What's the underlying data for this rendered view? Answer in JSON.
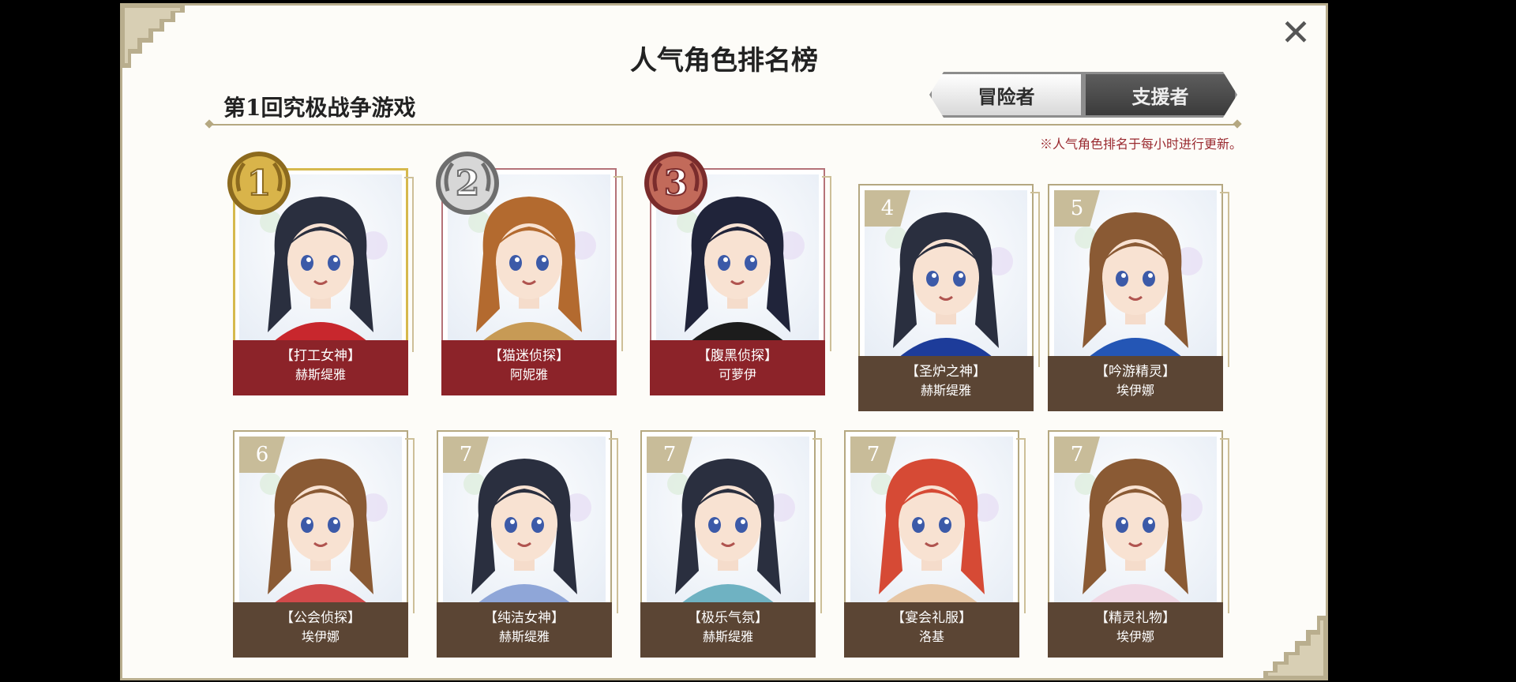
{
  "dialog": {
    "title": "人气角色排名榜",
    "subtitle": "第1回究极战争游戏",
    "note": "※人气角色排名于每小时进行更新。",
    "close_icon": "close-icon"
  },
  "tabs": [
    {
      "label": "冒险者",
      "active": true
    },
    {
      "label": "支援者",
      "active": false
    }
  ],
  "rankings": [
    {
      "rank": "1",
      "title": "【打工女神】",
      "name": "赫斯缇雅",
      "medal": "gold",
      "hair": "#2a2f3f",
      "accent": "#c8272d"
    },
    {
      "rank": "2",
      "title": "【猫迷侦探】",
      "name": "阿妮雅",
      "medal": "silver",
      "hair": "#b36a2f",
      "accent": "#c79a55"
    },
    {
      "rank": "3",
      "title": "【腹黑侦探】",
      "name": "可萝伊",
      "medal": "bronze",
      "hair": "#20243a",
      "accent": "#1c1c1c"
    },
    {
      "rank": "4",
      "title": "【圣炉之神】",
      "name": "赫斯缇雅",
      "medal": "",
      "hair": "#2a2f3f",
      "accent": "#1d3c9a"
    },
    {
      "rank": "5",
      "title": "【吟游精灵】",
      "name": "埃伊娜",
      "medal": "",
      "hair": "#8a5a34",
      "accent": "#2456b5"
    },
    {
      "rank": "6",
      "title": "【公会侦探】",
      "name": "埃伊娜",
      "medal": "",
      "hair": "#8a5a34",
      "accent": "#d14a4a"
    },
    {
      "rank": "7",
      "title": "【纯洁女神】",
      "name": "赫斯缇雅",
      "medal": "",
      "hair": "#2a2f3f",
      "accent": "#8fa6d8"
    },
    {
      "rank": "7",
      "title": "【极乐气氛】",
      "name": "赫斯缇雅",
      "medal": "",
      "hair": "#2a2f3f",
      "accent": "#6fb2c2"
    },
    {
      "rank": "7",
      "title": "【宴会礼服】",
      "name": "洛基",
      "medal": "",
      "hair": "#d64a35",
      "accent": "#e6c6a4"
    },
    {
      "rank": "7",
      "title": "【精灵礼物】",
      "name": "埃伊娜",
      "medal": "",
      "hair": "#8a5a34",
      "accent": "#f0d7e4"
    }
  ],
  "colors": {
    "plate_top": "#8c2329",
    "plate_other": "#5b4534",
    "frame_gold": "#d6b94d",
    "note_red": "#9a2a30"
  }
}
